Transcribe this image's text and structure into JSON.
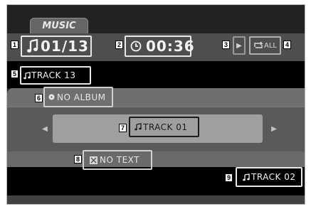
{
  "header": {
    "tab_label": "MUSIC"
  },
  "status_bar": {
    "track_counter": "01/13",
    "time": "00:36",
    "play_symbol": "▶",
    "repeat_label": "ALL"
  },
  "now_playing": {
    "current_track": "TRACK 13",
    "album": "NO ALBUM",
    "selected_track": "TRACK 01",
    "text_info": "NO TEXT",
    "next_track": "TRACK 02"
  },
  "nav": {
    "left_arrow": "◀",
    "right_arrow": "▶"
  },
  "callouts": [
    "1",
    "2",
    "3",
    "4",
    "5",
    "6",
    "7",
    "8",
    "9"
  ],
  "icons": [
    "music-note-icon",
    "clock-icon",
    "play-icon",
    "repeat-icon",
    "album-disc-icon",
    "text-icon"
  ],
  "colors": {
    "screen_bg": "#222222",
    "bar_bg": "#4e4e4e",
    "highlight_bg": "#9f9f9f",
    "box_border": "#e7e7e7"
  }
}
